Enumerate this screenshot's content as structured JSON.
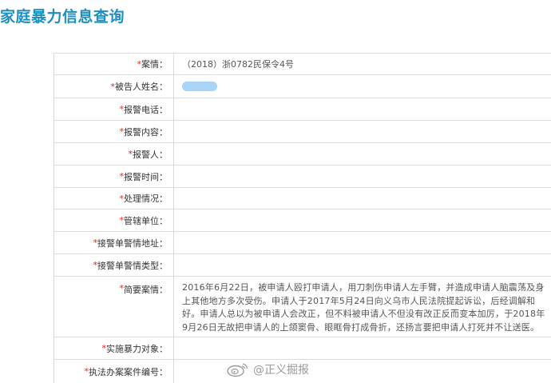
{
  "page": {
    "title": "家庭暴力信息查询"
  },
  "fields": [
    {
      "label": "案情：",
      "value": "（2018）浙0782民保令4号"
    },
    {
      "label": "被告人姓名：",
      "value": "",
      "redacted": true
    },
    {
      "label": "报警电话：",
      "value": ""
    },
    {
      "label": "报警内容：",
      "value": ""
    },
    {
      "label": "报警人：",
      "value": ""
    },
    {
      "label": "报警时间：",
      "value": ""
    },
    {
      "label": "处理情况：",
      "value": ""
    },
    {
      "label": "管辖单位：",
      "value": ""
    },
    {
      "label": "接警单警情地址：",
      "value": ""
    },
    {
      "label": "接警单警情类型：",
      "value": ""
    },
    {
      "label": "简要案情：",
      "value": "2016年6月22日，被申请人殴打申请人，用刀刺伤申请人左手臂，并造成申请人脑震荡及身上其他地方多次受伤。申请人于2017年5月24日向义乌市人民法院提起诉讼，后经调解和好。申请人总以为被申请人会改正，但不料被申请人不但没有改正反而变本加厉，于2018年9月26日无故把申请人的上颌窦骨、眼眶骨打成骨折，还扬言要把申请人打死并不让送医。"
    },
    {
      "label": "实施暴力对象：",
      "value": ""
    },
    {
      "label": "执法办案案件编号：",
      "value": ""
    }
  ],
  "required_mark": "*",
  "watermark": {
    "text": "@正义掘报",
    "icon": "weibo-icon"
  },
  "colors": {
    "title": "#1a8fc0",
    "required": "#e02020",
    "redacted": "#a8d4f5"
  }
}
